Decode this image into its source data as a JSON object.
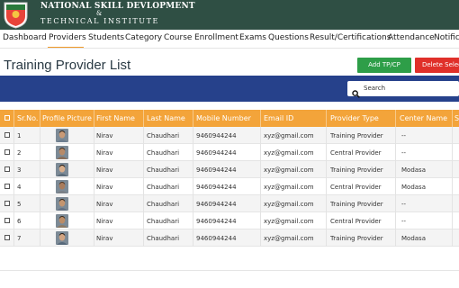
{
  "brand": {
    "line1": "NATIONAL SKILL DEVLOPMENT",
    "amp": "&",
    "line2": "TECHNICAL INSTITUTE"
  },
  "nav": {
    "items": [
      "Dashboard",
      "Providers",
      "Students",
      "Category",
      "Course",
      "Enrollment",
      "Exams",
      "Questions",
      "Result/Certifications",
      "Attendance",
      "Notifica"
    ],
    "active": "Providers"
  },
  "page": {
    "title": "Training Provider List",
    "add_label": "Add TP/CP",
    "delete_label": "Delete Selec"
  },
  "search": {
    "placeholder": "Search"
  },
  "table": {
    "columns": [
      "Sr.No.",
      "Profile Picture",
      "First Name",
      "Last Name",
      "Mobile Number",
      "Email ID",
      "Provider Type",
      "Center Name",
      "S"
    ],
    "rows": [
      {
        "sr": "1",
        "first": "Nirav",
        "last": "Chaudhari",
        "mobile": "9460944244",
        "email": "xyz@gmail.com",
        "type": "Training Provider",
        "center": "--"
      },
      {
        "sr": "2",
        "first": "Nirav",
        "last": "Chaudhari",
        "mobile": "9460944244",
        "email": "xyz@gmail.com",
        "type": "Central Provider",
        "center": "--"
      },
      {
        "sr": "3",
        "first": "Nirav",
        "last": "Chaudhari",
        "mobile": "9460944244",
        "email": "xyz@gmail.com",
        "type": "Training Provider",
        "center": "Modasa"
      },
      {
        "sr": "4",
        "first": "Nirav",
        "last": "Chaudhari",
        "mobile": "9460944244",
        "email": "xyz@gmail.com",
        "type": "Central Provider",
        "center": "Modasa"
      },
      {
        "sr": "5",
        "first": "Nirav",
        "last": "Chaudhari",
        "mobile": "9460944244",
        "email": "xyz@gmail.com",
        "type": "Training Provider",
        "center": "--"
      },
      {
        "sr": "6",
        "first": "Nirav",
        "last": "Chaudhari",
        "mobile": "9460944244",
        "email": "xyz@gmail.com",
        "type": "Central Provider",
        "center": "--"
      },
      {
        "sr": "7",
        "first": "Nirav",
        "last": "Chaudhari",
        "mobile": "9460944244",
        "email": "xyz@gmail.com",
        "type": "Training Provider",
        "center": "Modasa"
      }
    ]
  },
  "colors": {
    "topbar": "#2f4f44",
    "accent": "#f3a43a",
    "bluebar": "#26418b",
    "add_button": "#2e9e48",
    "delete_button": "#e0302a"
  }
}
